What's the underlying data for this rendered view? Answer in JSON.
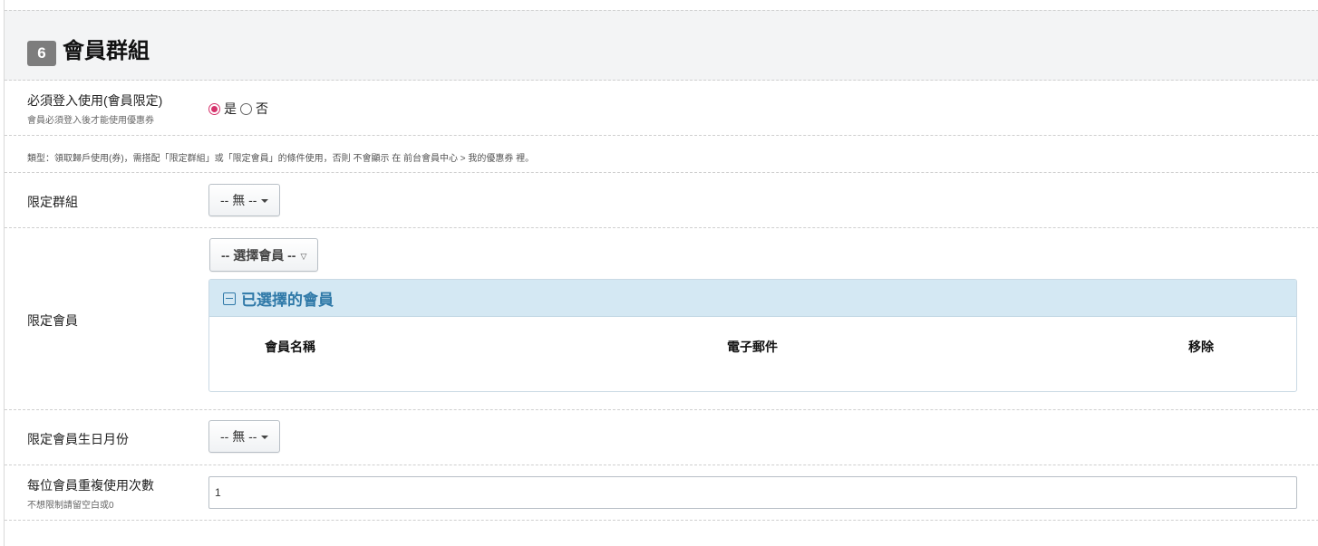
{
  "section": {
    "step": "6",
    "title": "會員群組"
  },
  "login_required": {
    "label": "必須登入使用(會員限定)",
    "sublabel": "會員必須登入後才能使用優惠券",
    "options": [
      {
        "label": "是",
        "selected": true
      },
      {
        "label": "否",
        "selected": false
      }
    ]
  },
  "note": "類型：領取歸戶使用(券)，需搭配「限定群組」或「限定會員」的條件使用，否則 不會顯示 在 前台會員中心 > 我的優惠券 裡。",
  "group_limit": {
    "label": "限定群組",
    "value": "-- 無 --"
  },
  "member_limit": {
    "label": "限定會員",
    "select_label": "-- 選擇會員 --",
    "panel_title": "已選擇的會員",
    "columns": [
      "會員名稱",
      "電子郵件",
      "移除"
    ]
  },
  "birthday_limit": {
    "label": "限定會員生日月份",
    "value": "-- 無 --"
  },
  "repeat_limit": {
    "label": "每位會員重複使用次數",
    "sublabel": "不想限制請留空白或0",
    "value": "1"
  },
  "colors": {
    "accent_radio": "#d6336c",
    "panel_header_bg": "#d4e8f3",
    "panel_title": "#2f79a8",
    "badge_bg": "#7d7d7d"
  }
}
